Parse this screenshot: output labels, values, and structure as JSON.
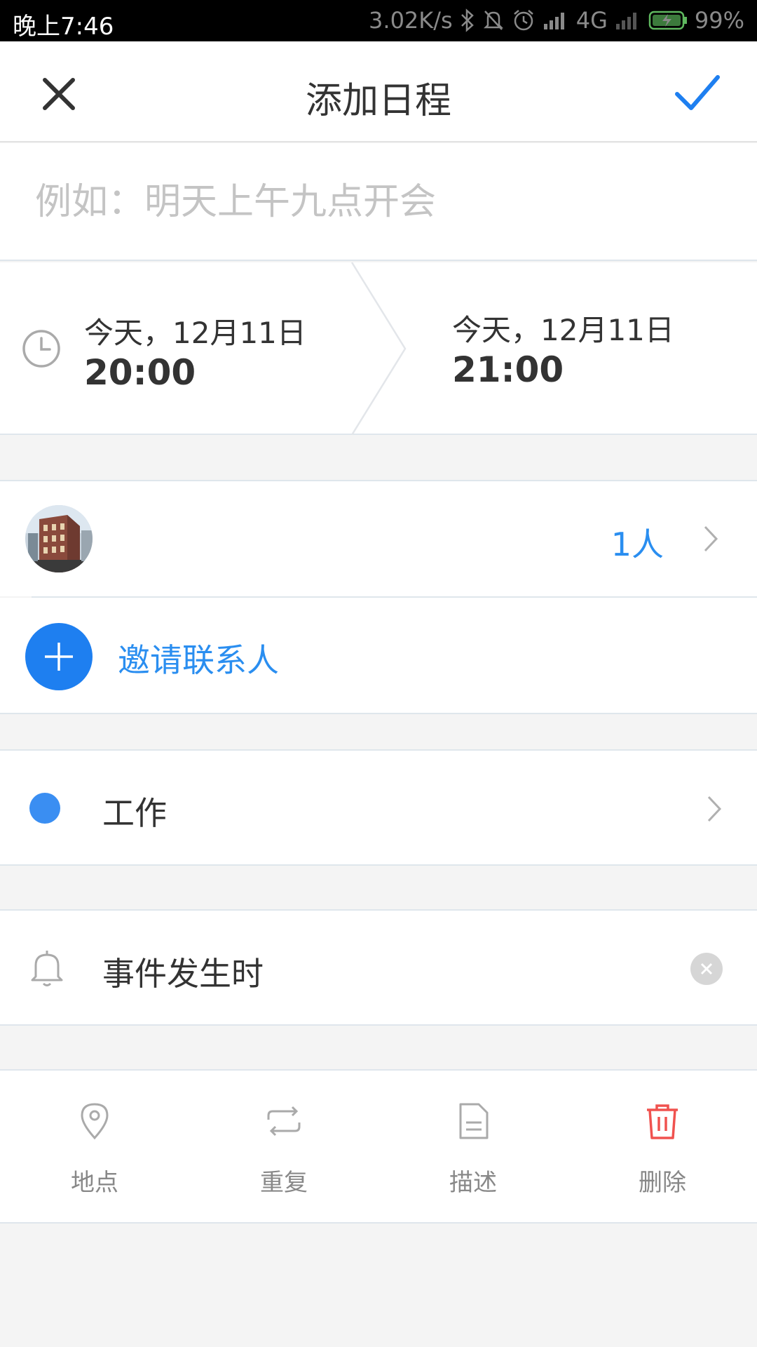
{
  "status_bar": {
    "time": "晚上7:46",
    "network_speed": "3.02K/s",
    "network_type": "4G",
    "battery": "99%"
  },
  "header": {
    "title": "添加日程",
    "close_icon": "close-icon",
    "confirm_icon": "check-icon"
  },
  "title_input": {
    "placeholder": "例如：明天上午九点开会",
    "value": ""
  },
  "time": {
    "start_date": "今天，12月11日",
    "start_time": "20:00",
    "end_date": "今天，12月11日",
    "end_time": "21:00"
  },
  "attendees": {
    "count_label": "1人"
  },
  "invite": {
    "label": "邀请联系人"
  },
  "category": {
    "label": "工作",
    "color": "#3a8ef2"
  },
  "reminder": {
    "label": "事件发生时"
  },
  "actions": [
    {
      "label": "地点",
      "icon": "location-pin-icon"
    },
    {
      "label": "重复",
      "icon": "repeat-icon"
    },
    {
      "label": "描述",
      "icon": "document-icon"
    },
    {
      "label": "删除",
      "icon": "trash-icon",
      "color": "#f0524f"
    }
  ],
  "colors": {
    "accent": "#2a8ef0",
    "invite_button": "#1e7ff0",
    "delete": "#f0524f"
  }
}
